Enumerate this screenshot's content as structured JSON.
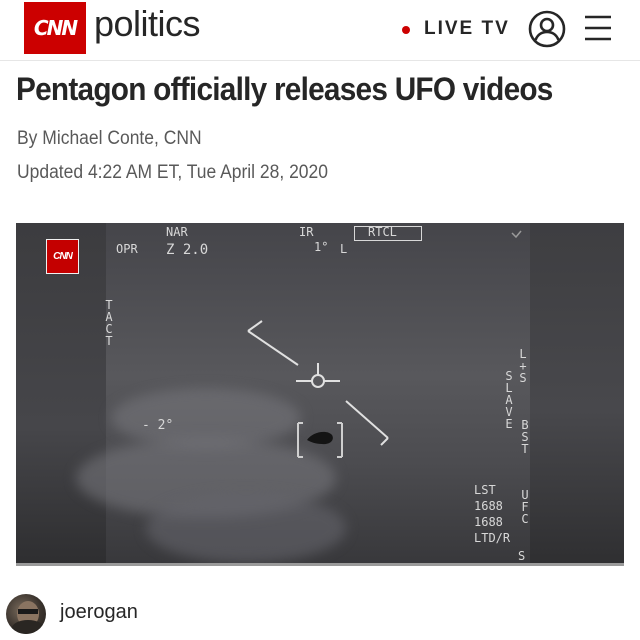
{
  "header": {
    "logo_text": "CNN",
    "section": "politics",
    "live_label": "LIVE TV",
    "icons": [
      "account-icon",
      "menu-icon"
    ],
    "brand_color": "#cc0000"
  },
  "article": {
    "headline": "Pentagon officially releases UFO videos",
    "byline": "By Michael Conte, CNN",
    "updated": "Updated 4:22 AM ET, Tue April 28, 2020"
  },
  "video": {
    "bug_text": "CNN",
    "hud": {
      "nar": "NAR",
      "opr": "OPR",
      "zoom": "Z 2.0",
      "ir": "IR",
      "rtcl": "RTCL",
      "deg1": "1°",
      "l_mark": "L",
      "tact": "TACT",
      "angle": "- 2°",
      "ls": "L+S",
      "slave": "SLAVE",
      "bst": "B S T",
      "lst": "LST",
      "lst_value1": "1688",
      "lst_value2": "1688",
      "ltd": "LTD/R",
      "ufc": "U F C",
      "s_mark": "S"
    }
  },
  "post": {
    "username": "joerogan"
  }
}
